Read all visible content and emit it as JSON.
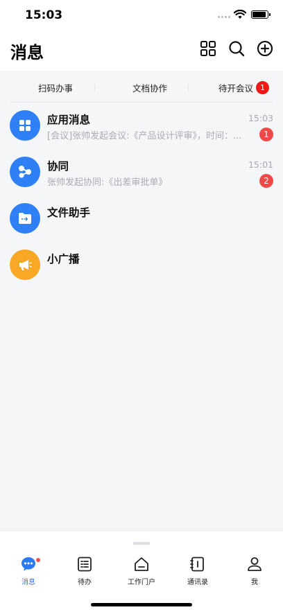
{
  "status_bar": {
    "time": "15:03"
  },
  "header": {
    "title": "消息"
  },
  "quick_tabs": [
    {
      "label": "扫码办事"
    },
    {
      "label": "文档协作"
    },
    {
      "label": "待开会议",
      "badge": "1"
    }
  ],
  "messages": [
    {
      "name": "应用消息",
      "time": "15:03",
      "preview": "[会议]张帅发起会议:《产品设计评审》，时间：...",
      "badge": "1",
      "avatar_color": "#2f80f6",
      "icon": "apps-icon"
    },
    {
      "name": "协同",
      "time": "15:01",
      "preview": "张帅发起协同:《出差审批单》",
      "badge": "2",
      "avatar_color": "#2f80f6",
      "icon": "share-icon"
    },
    {
      "name": "文件助手",
      "avatar_color": "#2f80f6",
      "icon": "folder-icon"
    },
    {
      "name": "小广播",
      "avatar_color": "#f9a825",
      "icon": "megaphone-icon"
    }
  ],
  "tabs": [
    {
      "label": "消息",
      "active": true,
      "icon": "chat-icon"
    },
    {
      "label": "待办",
      "icon": "todo-list-icon"
    },
    {
      "label": "工作门户",
      "icon": "home-icon"
    },
    {
      "label": "通讯录",
      "icon": "contacts-icon"
    },
    {
      "label": "我",
      "icon": "person-icon"
    }
  ],
  "colors": {
    "accent": "#2a7af3",
    "badge_red": "#ef4a4a",
    "broadcast_orange": "#f9a825"
  }
}
